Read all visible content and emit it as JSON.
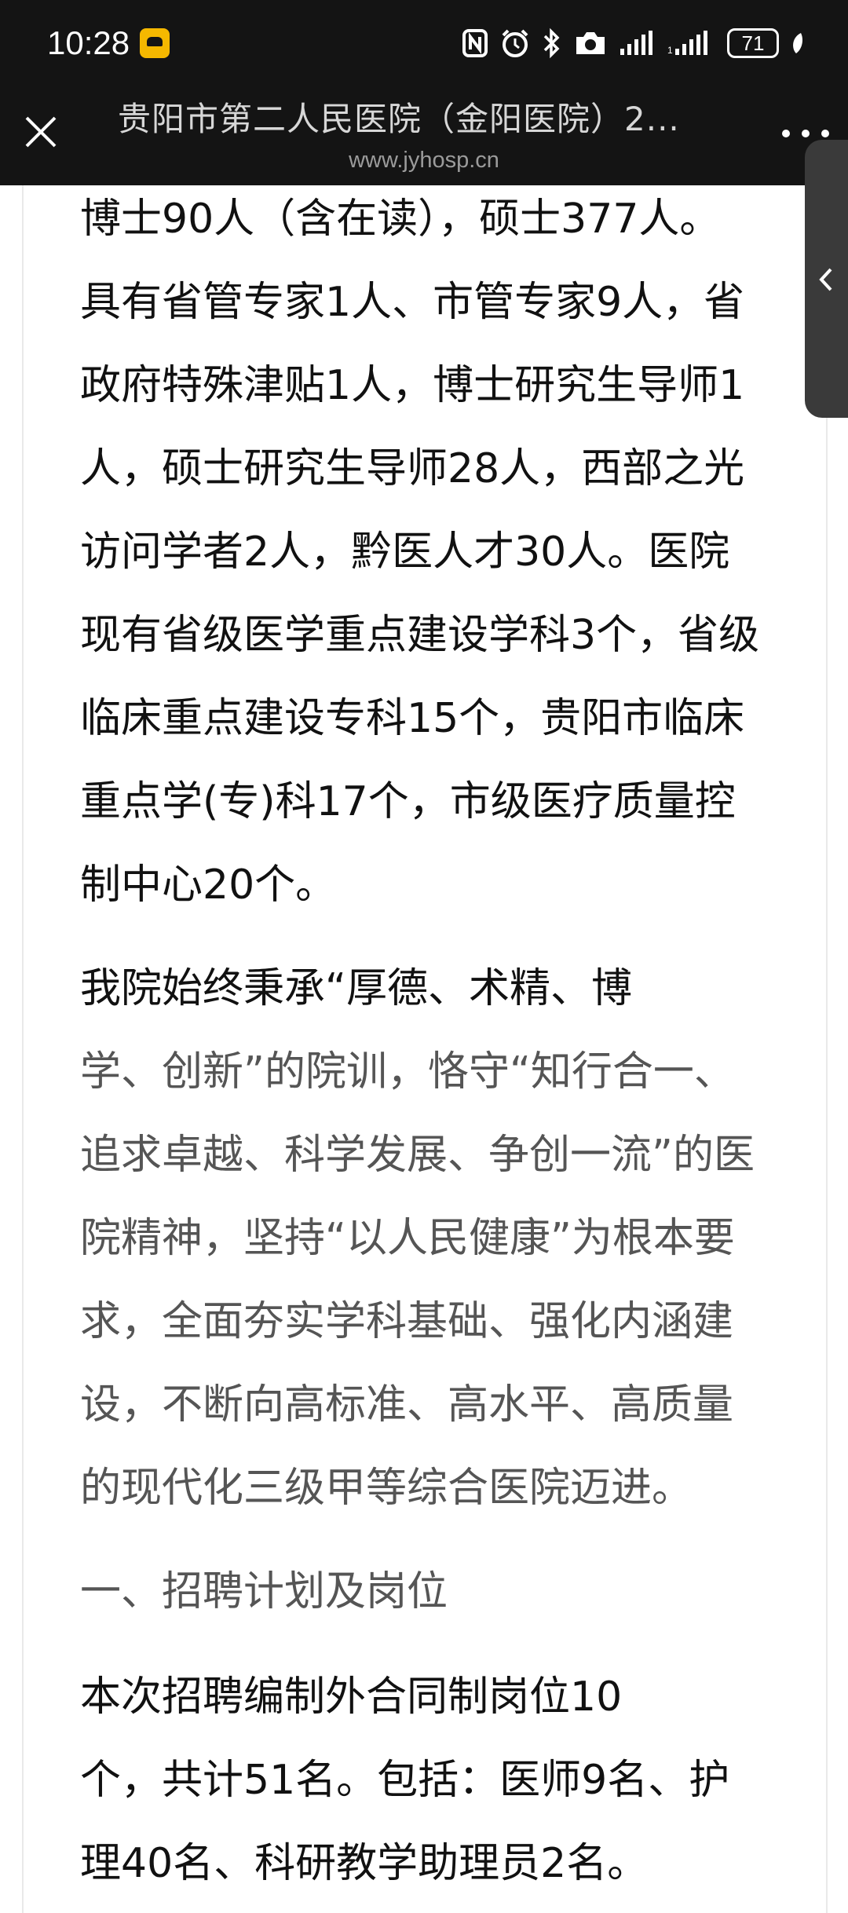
{
  "status_bar": {
    "time": "10:28",
    "battery": "71",
    "icons": [
      "nfc-icon",
      "alarm-icon",
      "bluetooth-icon",
      "camera-icon",
      "signal-icon",
      "signal-icon",
      "battery-icon",
      "leaf-icon"
    ]
  },
  "header": {
    "title": "贵阳市第二人民医院（金阳医院）2...",
    "url": "www.jyhosp.cn"
  },
  "article": {
    "lines": [
      "博士90人（含在读），硕士377人。",
      "具有省管专家1人、市管专家9人，省",
      "政府特殊津贴1人，博士研究生导师1",
      "人，硕士研究生导师28人，西部之光",
      "访问学者2人，黔医人才30人。医院",
      "现有省级医学重点建设学科3个，省级",
      "临床重点建设专科15个，贵阳市临床",
      "重点学(专)科17个，市级医疗质量控",
      "制中心20个。",
      "    我院始终秉承“厚德、术精、博",
      "学、创新”的院训，恪守“知行合一、",
      "追求卓越、科学发展、争创一流”的医",
      "院精神，坚持“以人民健康”为根本要",
      "求，全面夯实学科基础、强化内涵建",
      "设，不断向高标准、高水平、高质量",
      "的现代化三级甲等综合医院迈进。",
      "    一、招聘计划及岗位",
      "    本次招聘编制外合同制岗位10",
      "个，共计51名。包括：医师9名、护",
      "理40名、科研教学助理员2名。"
    ]
  }
}
